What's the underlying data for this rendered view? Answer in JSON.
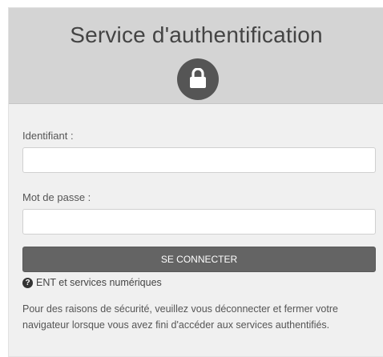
{
  "header": {
    "title": "Service d'authentification",
    "icon": "lock-icon"
  },
  "form": {
    "username_label": "Identifiant :",
    "username_value": "",
    "password_label": "Mot de passe :",
    "password_value": "",
    "submit_label": "SE CONNECTER"
  },
  "help": {
    "icon": "question-circle-icon",
    "link_text": "ENT et services numériques"
  },
  "notice": {
    "text": "Pour des raisons de sécurité, veuillez vous déconnecter et fermer votre navigateur lorsque vous avez fini d'accéder aux services authentifiés."
  },
  "colors": {
    "header_bg": "#d4d4d4",
    "card_bg": "#f0f0f0",
    "button_bg": "#646464",
    "lock_circle": "#555555"
  }
}
